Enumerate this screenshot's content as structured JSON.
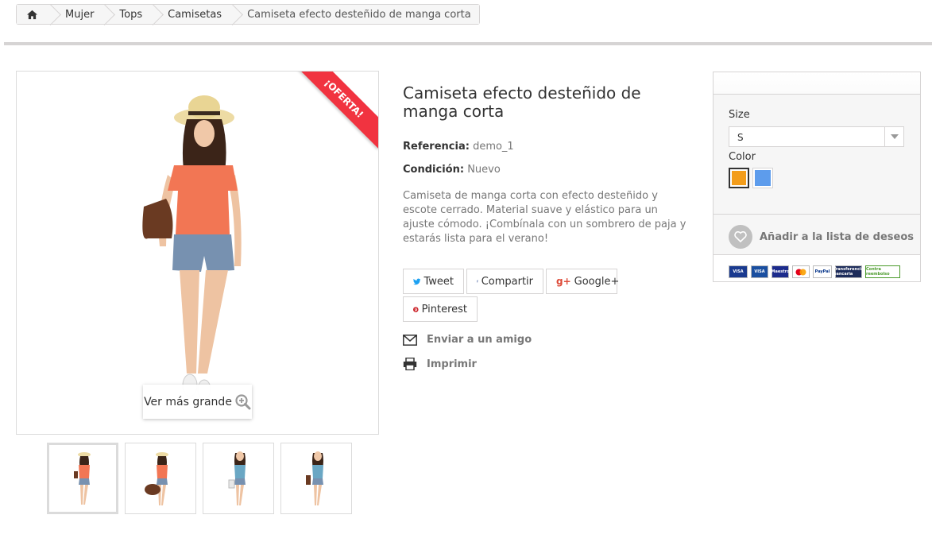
{
  "breadcrumb": {
    "home_icon": "home-icon",
    "items": [
      "Mujer",
      "Tops",
      "Camisetas"
    ],
    "current": "Camiseta efecto desteñido de manga corta"
  },
  "product": {
    "badge": "¡OFERTA!",
    "zoom_label": "Ver más grande",
    "zoom_icon": "magnifier-plus-icon",
    "title": "Camiseta efecto desteñido de manga corta",
    "reference_label": "Referencia:",
    "reference_value": "demo_1",
    "condition_label": "Condición:",
    "condition_value": "Nuevo",
    "description": "Camiseta de manga corta con efecto desteñido y escote cerrado. Material suave y elástico para un ajuste cómodo. ¡Combínala con un sombrero de paja y estarás lista para el verano!",
    "thumbnails": [
      {
        "top": "#f27654",
        "bottom": "#7791b0",
        "bag": false
      },
      {
        "top": "#f27654",
        "bottom": "#7791b0",
        "bag": true
      },
      {
        "top": "#6aa7c4",
        "bottom": "#7791b0",
        "bag": false
      },
      {
        "top": "#6aa7c4",
        "bottom": "#7791b0",
        "bag": true
      }
    ]
  },
  "share": {
    "tweet": "Tweet",
    "share": "Compartir",
    "google": "Google+",
    "pinterest": "Pinterest"
  },
  "actions": {
    "send_friend": "Enviar a un amigo",
    "print": "Imprimir"
  },
  "cart": {
    "size_label": "Size",
    "size_value": "S",
    "color_label": "Color",
    "colors": [
      "#f39d1b",
      "#5d9cec"
    ],
    "wishlist": "Añadir a la lista de deseos",
    "payments": [
      "VISA",
      "VISA",
      "Maestro",
      "Master",
      "PayPal",
      "Transferencia bancaria",
      "Contra reembolso"
    ]
  },
  "colors": {
    "ribbon": "#f13340",
    "twitter": "#1da1f2",
    "facebook": "#3b5998",
    "google": "#dd4b39",
    "pinterest": "#cb2027"
  }
}
